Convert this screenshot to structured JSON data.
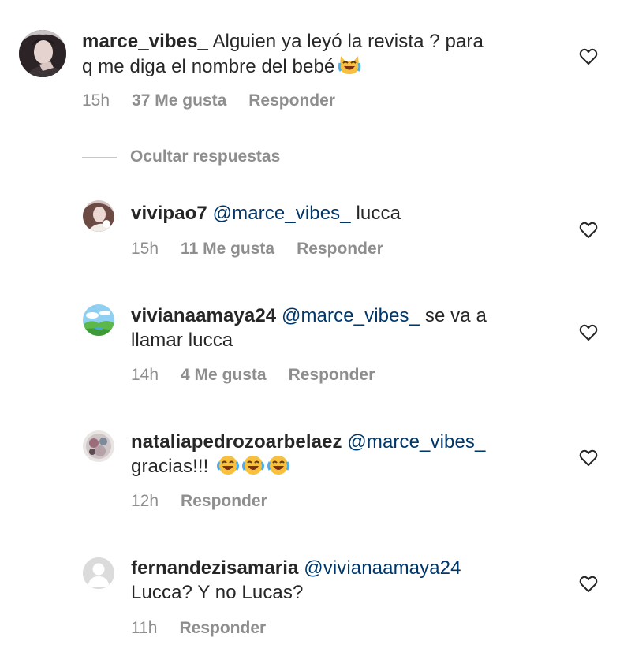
{
  "main_comment": {
    "username": "marce_vibes_",
    "text_line1": "Alguien ya leyó la revista ? para",
    "text_line2": "q me diga el nombre del bebé",
    "emoji": "laughing-cat-emoji",
    "time": "15h",
    "likes": "37 Me gusta",
    "reply": "Responder"
  },
  "hide_replies_label": "Ocultar respuestas",
  "replies": [
    {
      "username": "vivipao7",
      "mention": "@marce_vibes_",
      "text": "lucca",
      "time": "15h",
      "likes": "11 Me gusta",
      "reply": "Responder"
    },
    {
      "username": "vivianaamaya24",
      "mention": "@marce_vibes_",
      "text": "se va a",
      "text_line2": "llamar lucca",
      "time": "14h",
      "likes": "4 Me gusta",
      "reply": "Responder"
    },
    {
      "username": "nataliapedrozoarbelaez",
      "mention": "@marce_vibes_",
      "text_line2": "gracias!!!",
      "emoji": "tears-of-joy-emoji",
      "time": "12h",
      "reply": "Responder"
    },
    {
      "username": "fernandezisamaria",
      "mention": "@vivianaamaya24",
      "text_line2": "Lucca? Y no Lucas?",
      "time": "11h",
      "reply": "Responder"
    }
  ],
  "colors": {
    "text": "#262626",
    "meta": "#8e8e8e",
    "mention": "#00376b",
    "line": "#c7c7c7"
  }
}
